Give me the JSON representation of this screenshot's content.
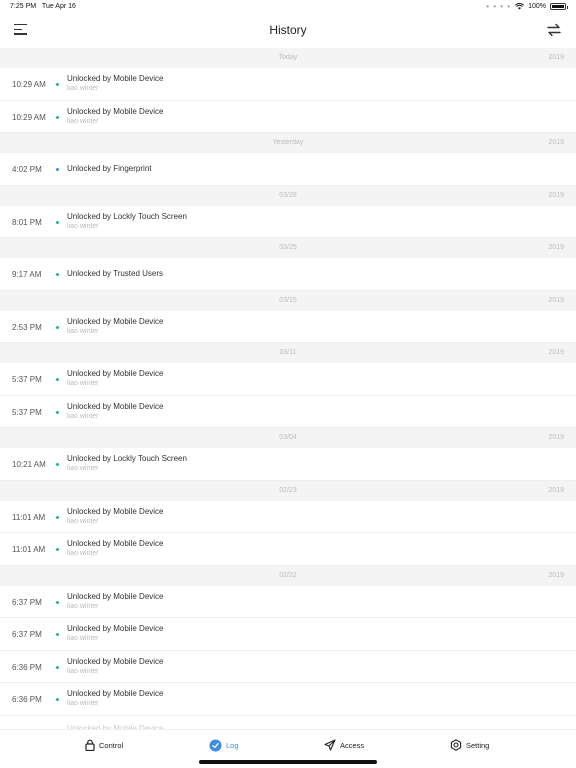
{
  "status": {
    "time": "7:25 PM",
    "date": "Tue Apr 16",
    "battery": "100%"
  },
  "header": {
    "title": "History"
  },
  "sections": [
    {
      "date": "Today",
      "year": "2019",
      "rows": [
        {
          "time": "10:29 AM",
          "event": "Unlocked by Mobile Device",
          "user": "liao winter",
          "dot": "green"
        },
        {
          "time": "10:29 AM",
          "event": "Unlocked by Mobile Device",
          "user": "liao winter",
          "dot": "green"
        }
      ]
    },
    {
      "date": "Yesterday",
      "year": "2019",
      "rows": [
        {
          "time": "4:02 PM",
          "event": "Unlocked by Fingerprint",
          "user": "",
          "dot": "blue"
        }
      ]
    },
    {
      "date": "03/28",
      "year": "2019",
      "rows": [
        {
          "time": "8:01 PM",
          "event": "Unlocked by Lockly Touch Screen",
          "user": "liao winter",
          "dot": "green"
        }
      ]
    },
    {
      "date": "03/25",
      "year": "2019",
      "rows": [
        {
          "time": "9:17 AM",
          "event": "Unlocked by Trusted Users",
          "user": "",
          "dot": "green"
        }
      ]
    },
    {
      "date": "03/15",
      "year": "2019",
      "rows": [
        {
          "time": "2:53 PM",
          "event": "Unlocked by Mobile Device",
          "user": "liao winter",
          "dot": "green"
        }
      ]
    },
    {
      "date": "03/11",
      "year": "2019",
      "rows": [
        {
          "time": "5:37 PM",
          "event": "Unlocked by Mobile Device",
          "user": "liao winter",
          "dot": "green"
        },
        {
          "time": "5:37 PM",
          "event": "Unlocked by Mobile Device",
          "user": "liao winter",
          "dot": "green"
        }
      ]
    },
    {
      "date": "03/04",
      "year": "2019",
      "rows": [
        {
          "time": "10:21 AM",
          "event": "Unlocked by Lockly Touch Screen",
          "user": "liao winter",
          "dot": "green"
        }
      ]
    },
    {
      "date": "02/23",
      "year": "2019",
      "rows": [
        {
          "time": "11:01 AM",
          "event": "Unlocked by Mobile Device",
          "user": "liao winter",
          "dot": "green"
        },
        {
          "time": "11:01 AM",
          "event": "Unlocked by Mobile Device",
          "user": "liao winter",
          "dot": "green"
        }
      ]
    },
    {
      "date": "02/22",
      "year": "2019",
      "rows": [
        {
          "time": "6:37 PM",
          "event": "Unlocked by Mobile Device",
          "user": "liao winter",
          "dot": "green"
        },
        {
          "time": "6:37 PM",
          "event": "Unlocked by Mobile Device",
          "user": "liao winter",
          "dot": "green"
        },
        {
          "time": "6:36 PM",
          "event": "Unlocked by Mobile Device",
          "user": "liao winter",
          "dot": "green"
        },
        {
          "time": "6:36 PM",
          "event": "Unlocked by Mobile Device",
          "user": "liao winter",
          "dot": "green"
        }
      ]
    }
  ],
  "tabbar": {
    "control": "Control",
    "log": "Log",
    "access": "Access",
    "setting": "Setting"
  },
  "colors": {
    "accent": "#3a8ee6",
    "dot_green": "#1cb98a"
  }
}
